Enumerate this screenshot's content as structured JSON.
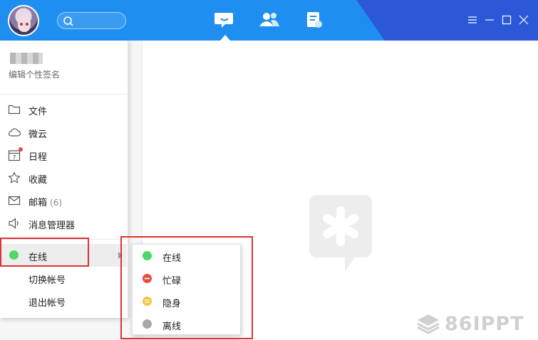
{
  "profile": {
    "signature_placeholder": "编辑个性签名"
  },
  "menu": {
    "items": [
      {
        "label": "文件",
        "icon": "folder-icon"
      },
      {
        "label": "微云",
        "icon": "cloud-icon"
      },
      {
        "label": "日程",
        "icon": "calendar-icon",
        "calendar_day": "7",
        "has_notification_dot": true
      },
      {
        "label": "收藏",
        "icon": "star-icon"
      },
      {
        "label": "邮箱",
        "icon": "mail-icon",
        "count": "(6)"
      },
      {
        "label": "消息管理器",
        "icon": "speaker-icon"
      }
    ],
    "status_label": "在线",
    "switch_account": "切换帐号",
    "logout": "退出帐号"
  },
  "status_submenu": {
    "items": [
      {
        "label": "在线",
        "color": "#4cd964"
      },
      {
        "label": "忙碌",
        "color": "#e84c3d"
      },
      {
        "label": "隐身",
        "color": "#f5c341"
      },
      {
        "label": "离线",
        "color": "#a8a8a8"
      }
    ]
  },
  "colors": {
    "titlebar": "#1e8ff0",
    "online": "#4cd964",
    "highlight": "#e03131"
  },
  "watermark": {
    "text": "86IPPT"
  }
}
